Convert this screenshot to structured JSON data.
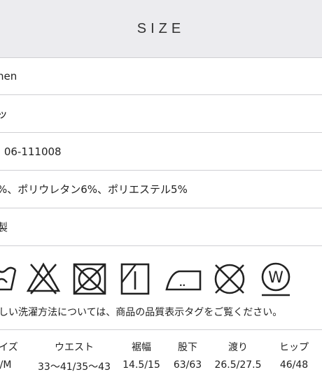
{
  "header": {
    "title": "SIZE"
  },
  "rows": [
    {
      "value": "nen"
    },
    {
      "value": "ッ"
    },
    {
      "value": ": 06-111008"
    },
    {
      "value": "%、ポリウレタン6%、ポリエステル5%"
    },
    {
      "value": "製"
    }
  ],
  "care": {
    "icons": [
      "hand-wash-icon",
      "no-bleach-icon",
      "no-tumble-dry-icon",
      "line-dry-icon",
      "iron-low-icon",
      "no-dry-clean-icon",
      "wet-clean-icon"
    ],
    "wet_clean_letter": "W",
    "iron_dots": "..",
    "note": "しい洗濯方法については、商品の品質表示タグをご覧ください。"
  },
  "size_table": {
    "headers": [
      "イズ",
      "ウエスト",
      "裾幅",
      "股下",
      "渡り",
      "ヒップ"
    ],
    "values": [
      "/M",
      "33〜41/35〜43",
      "14.5/15",
      "63/63",
      "26.5/27.5",
      "46/48"
    ]
  }
}
